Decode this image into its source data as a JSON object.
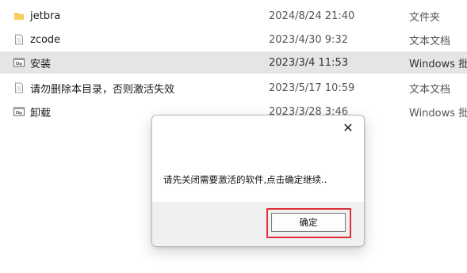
{
  "files": [
    {
      "name": "jetbra",
      "date": "2024/8/24 21:40",
      "type": "文件夹",
      "icon": "folder-icon",
      "selected": false
    },
    {
      "name": "zcode",
      "date": "2023/4/30 9:32",
      "type": "文本文档",
      "icon": "text-file-icon",
      "selected": false
    },
    {
      "name": "安装",
      "date": "2023/3/4 11:53",
      "type": "Windows 批",
      "icon": "batch-file-icon",
      "selected": true
    },
    {
      "name": "请勿删除本目录，否则激活失效",
      "date": "2023/5/17 10:59",
      "type": "文本文档",
      "icon": "text-file-icon",
      "selected": false
    },
    {
      "name": "卸载",
      "date": "2023/3/28 3:46",
      "type": "Windows 批",
      "icon": "batch-file-icon",
      "selected": false
    }
  ],
  "dialog": {
    "close_label": "✕",
    "message": "请先关闭需要激活的软件,点击确定继续..",
    "ok_label": "确定"
  },
  "colors": {
    "selected_row": "#e5e5e5",
    "folder": "#f2c144",
    "highlight": "#e0303a",
    "dialog_footer": "#f0f0f0"
  }
}
